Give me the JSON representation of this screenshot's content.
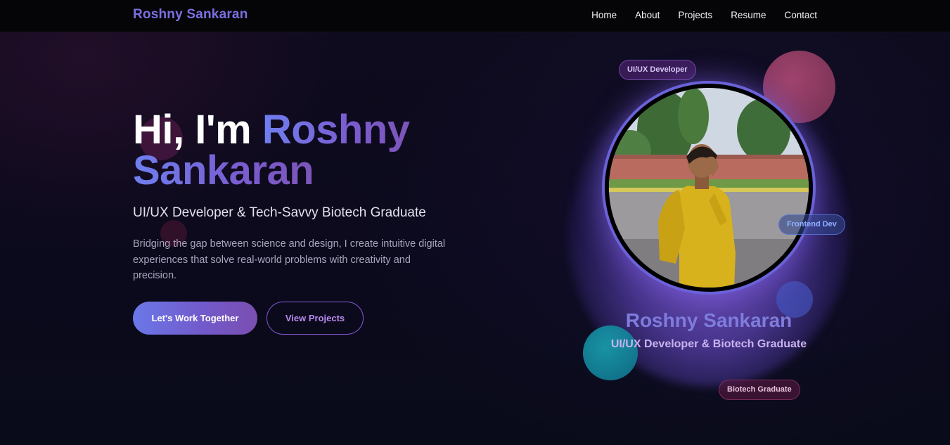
{
  "nav": {
    "brand": "Roshny Sankaran",
    "links": [
      "Home",
      "About",
      "Projects",
      "Resume",
      "Contact"
    ]
  },
  "hero": {
    "greeting": "Hi, I'm",
    "first_name": "Roshny",
    "last_name": "Sankaran",
    "subtitle": "UI/UX Developer & Tech-Savvy Biotech Graduate",
    "description": "Bridging the gap between science and design, I create intuitive digital experiences that solve real-world problems with creativity and precision.",
    "primary_button": "Let's Work Together",
    "secondary_button": "View Projects"
  },
  "profile_card": {
    "name": "Roshny Sankaran",
    "role": "UI/UX Developer & Biotech Graduate",
    "tags": [
      "UI/UX Developer",
      "Frontend Dev",
      "Biotech Graduate"
    ]
  },
  "colors": {
    "brand": "#7a6fe0",
    "accent_start": "#6b78e8",
    "accent_end": "#7a4fb0",
    "background": "#0d0b1d"
  }
}
